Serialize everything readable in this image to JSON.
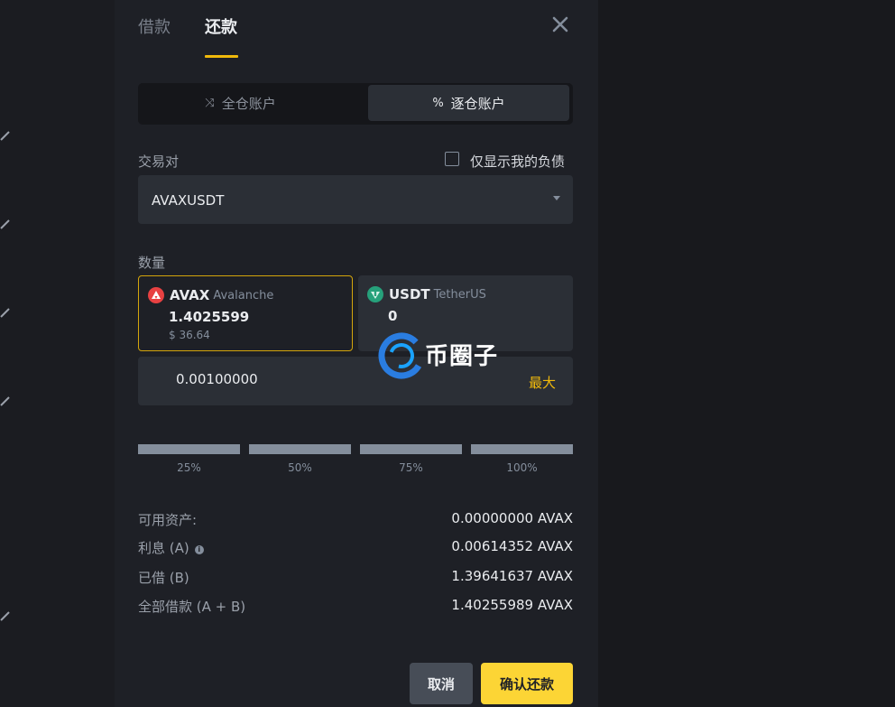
{
  "tabs": {
    "borrow": "借款",
    "repay": "还款"
  },
  "account_switch": {
    "cross": "全仓账户",
    "isolated": "逐仓账户"
  },
  "pair": {
    "label": "交易对",
    "value": "AVAXUSDT",
    "only_my_debt": "仅显示我的负债"
  },
  "quantity": {
    "label": "数量",
    "assets": [
      {
        "symbol": "AVAX",
        "name": "Avalanche",
        "amount": "1.4025599",
        "usd": "$ 36.64"
      },
      {
        "symbol": "USDT",
        "name": "TetherUS",
        "amount": "0"
      }
    ],
    "input_value": "0.00100000",
    "max_label": "最大"
  },
  "percentages": [
    "25%",
    "50%",
    "75%",
    "100%"
  ],
  "info": [
    {
      "label": "可用资产:",
      "value": "0.00000000 AVAX"
    },
    {
      "label": "利息 (A)",
      "value": "0.00614352 AVAX"
    },
    {
      "label": "已借 (B)",
      "value": "1.39641637 AVAX"
    },
    {
      "label": "全部借款 (A + B)",
      "value": "1.40255989 AVAX"
    }
  ],
  "buttons": {
    "cancel": "取消",
    "confirm": "确认还款"
  },
  "watermark": "币圈子",
  "colors": {
    "accent": "#f0b90b",
    "confirm_bg": "#fcd535",
    "avax": "#e84142",
    "usdt": "#26a17b"
  }
}
